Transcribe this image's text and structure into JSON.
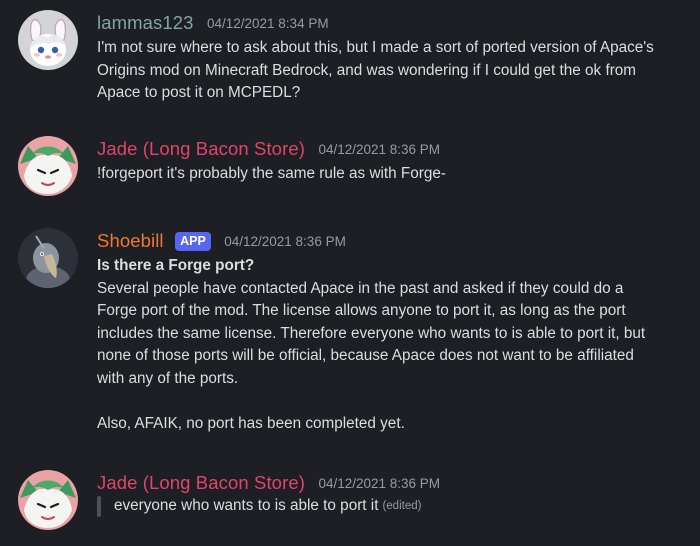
{
  "messages": [
    {
      "username": "lammas123",
      "username_color": "#7ea6a8",
      "timestamp": "04/12/2021 8:34 PM",
      "avatar_icon": "white-bunny-avatar",
      "lines": [
        "I'm not sure where to ask about this, but I made a sort of ported version of Apace's",
        "Origins mod on Minecraft Bedrock, and was wondering if I could get the ok from",
        "Apace to post it on MCPEDL?"
      ]
    },
    {
      "username": "Jade (Long Bacon Store)",
      "username_color": "#e0446b",
      "timestamp": "04/12/2021 8:36 PM",
      "avatar_icon": "green-dragon-avatar",
      "lines": [
        "!forgeport it's probably the same rule as with Forge-"
      ]
    },
    {
      "username": "Shoebill",
      "username_color": "#f0772f",
      "badge": "APP",
      "timestamp": "04/12/2021 8:36 PM",
      "avatar_icon": "shoebill-bird-avatar",
      "question": "Is there a Forge port?",
      "lines": [
        "Several people have contacted Apace in the past and asked if they could do a",
        "Forge port of the mod. The license allows anyone to port it, as long as the port",
        "includes the same license. Therefore everyone who wants to is able to port it, but",
        "none of those ports will be official, because Apace does not want to be affiliated",
        "with any of the ports."
      ],
      "footer": "Also, AFAIK, no port has been completed yet."
    },
    {
      "username": "Jade (Long Bacon Store)",
      "username_color": "#e0446b",
      "timestamp": "04/12/2021 8:36 PM",
      "avatar_icon": "green-dragon-avatar",
      "quote": "everyone who wants to is able to port it",
      "edited_label": "(edited)"
    }
  ]
}
